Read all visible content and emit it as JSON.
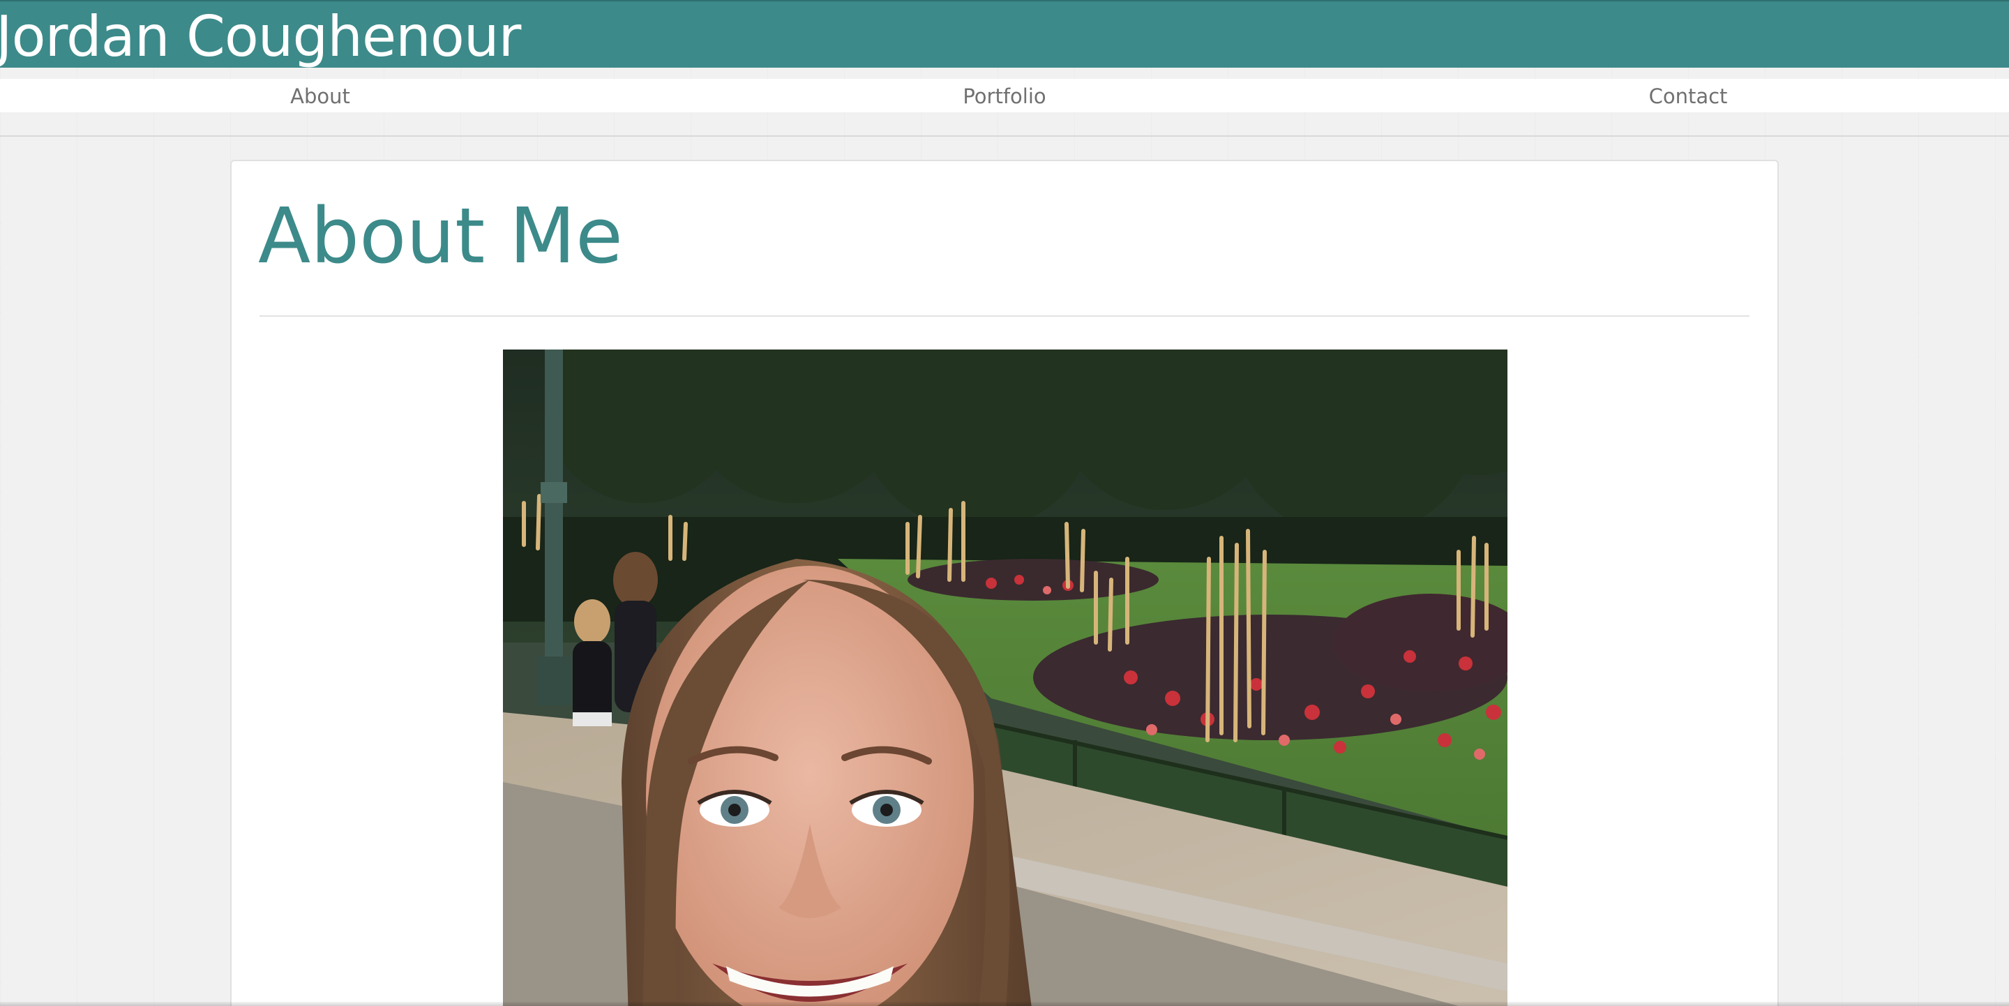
{
  "header": {
    "site_title": "Jordan Coughenour",
    "background_color": "#3d8a8a"
  },
  "nav": {
    "items": [
      {
        "label": "About"
      },
      {
        "label": "Portfolio"
      },
      {
        "label": "Contact"
      }
    ],
    "text_color": "#707070"
  },
  "main": {
    "heading": "About Me",
    "heading_color": "#3d8a8a",
    "photo": {
      "subject": "selfie-portrait-in-garden",
      "icon": "profile-photo"
    }
  }
}
